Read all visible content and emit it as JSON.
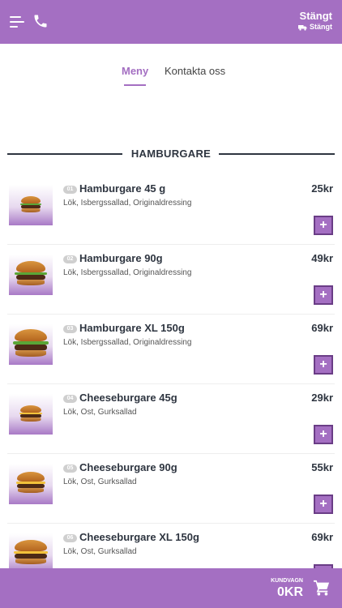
{
  "header": {
    "status_main": "Stängt",
    "status_sub": "Stängt",
    "accent": "#a46fc2"
  },
  "tabs": [
    {
      "label": "Meny",
      "active": true
    },
    {
      "label": "Kontakta oss",
      "active": false
    }
  ],
  "section": {
    "title": "HAMBURGARE"
  },
  "items": [
    {
      "num": "01",
      "name": "Hamburgare 45 g",
      "desc": "Lök, Isbergssallad, Originaldressing",
      "price": "25kr",
      "add": "+"
    },
    {
      "num": "02",
      "name": "Hamburgare 90g",
      "desc": "Lök, Isbergssallad, Originaldressing",
      "price": "49kr",
      "add": "+"
    },
    {
      "num": "03",
      "name": "Hamburgare XL 150g",
      "desc": "Lök, Isbergssallad, Originaldressing",
      "price": "69kr",
      "add": "+"
    },
    {
      "num": "04",
      "name": "Cheeseburgare 45g",
      "desc": "Lök, Ost, Gurksallad",
      "price": "29kr",
      "add": "+"
    },
    {
      "num": "05",
      "name": "Cheeseburgare 90g",
      "desc": "Lök, Ost, Gurksallad",
      "price": "55kr",
      "add": "+"
    },
    {
      "num": "06",
      "name": "Cheeseburgare XL 150g",
      "desc": "Lök, Ost, Gurksallad",
      "price": "69kr",
      "add": "+"
    }
  ],
  "cart": {
    "label": "KUNDVAGN",
    "total": "0KR"
  },
  "icons": {
    "menu": "menu-icon",
    "phone": "phone-icon",
    "truck": "truck-icon",
    "cart": "cart-icon"
  }
}
